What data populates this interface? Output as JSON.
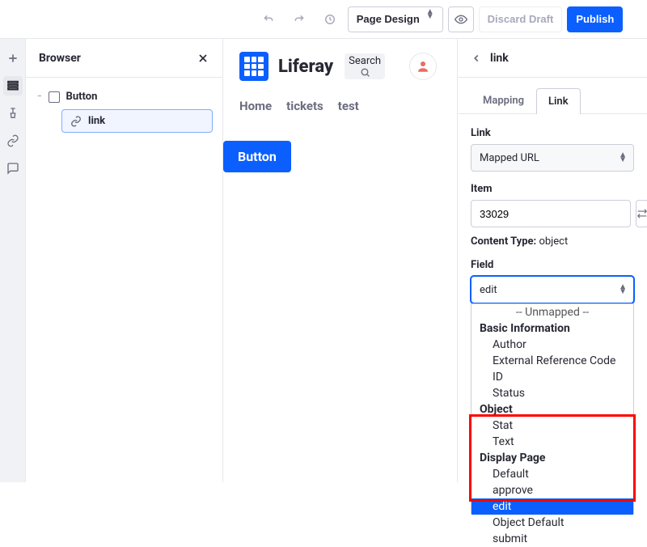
{
  "toolbar": {
    "page_design_label": "Page Design",
    "discard_label": "Discard Draft",
    "publish_label": "Publish"
  },
  "browser": {
    "title": "Browser",
    "tree": {
      "root_label": "Button",
      "child_label": "link"
    }
  },
  "canvas": {
    "site_title": "Liferay",
    "search_label": "Search",
    "nav": [
      "Home",
      "tickets",
      "test"
    ],
    "button_label": "Button"
  },
  "right": {
    "title": "link",
    "tabs": {
      "mapping": "Mapping",
      "link": "Link"
    },
    "link_section_label": "Link",
    "link_select_value": "Mapped URL",
    "item_label": "Item",
    "item_value": "33029",
    "content_type_key": "Content Type:",
    "content_type_value": "object",
    "field_label": "Field",
    "field_select_value": "edit",
    "dropdown": {
      "unmapped": "-- Unmapped --",
      "group_basic": "Basic Information",
      "basic_author": "Author",
      "basic_erc": "External Reference Code",
      "basic_id": "ID",
      "basic_status": "Status",
      "group_object": "Object",
      "object_stat": "Stat",
      "object_text": "Text",
      "group_display": "Display Page",
      "display_default": "Default",
      "display_approve": "approve",
      "display_edit": "edit",
      "display_object_default": "Object Default",
      "display_submit": "submit"
    }
  }
}
